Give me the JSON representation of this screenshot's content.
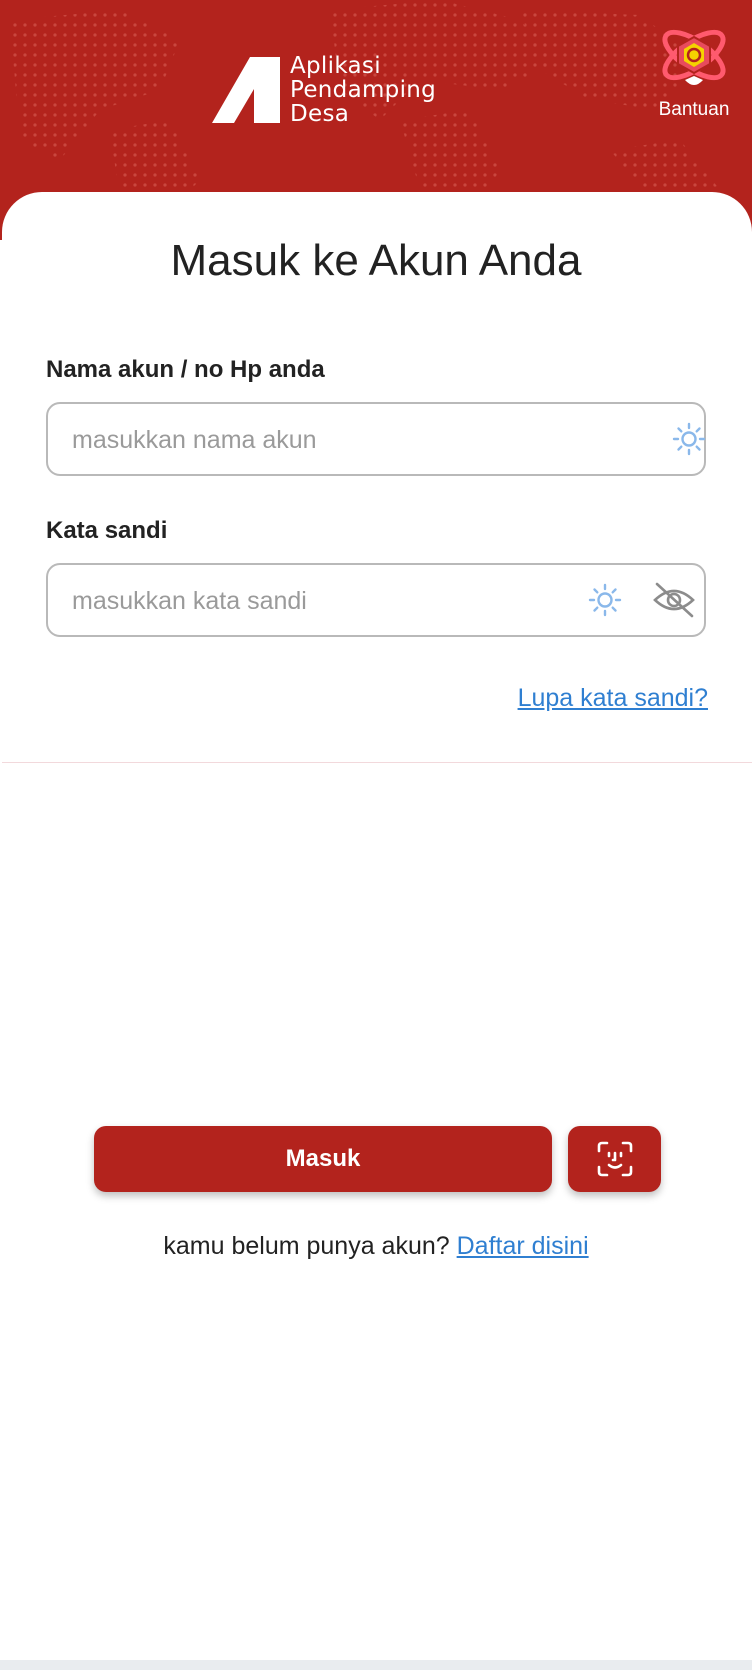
{
  "header": {
    "logo_line1": "Aplikasi",
    "logo_line2": "Pendamping",
    "logo_line3": "Desa",
    "help_label": "Bantuan",
    "help_icon": "atom-hexagon-icon",
    "background_color": "#b3231d"
  },
  "login": {
    "title": "Masuk ke Akun Anda",
    "username": {
      "label": "Nama akun / no Hp anda",
      "placeholder": "masukkan nama akun",
      "value": ""
    },
    "password": {
      "label": "Kata sandi",
      "placeholder": "masukkan kata sandi",
      "value": "",
      "visibility_icon": "eye-off-icon"
    },
    "forgot_link": "Lupa kata sandi?"
  },
  "actions": {
    "login_label": "Masuk",
    "face_login_icon": "face-scan-icon"
  },
  "signup": {
    "prompt": "kamu belum punya akun? ",
    "link": "Daftar disini"
  },
  "colors": {
    "primary": "#b3231d",
    "link": "#2f7fd1",
    "field_icon": "#8ab8ea"
  }
}
